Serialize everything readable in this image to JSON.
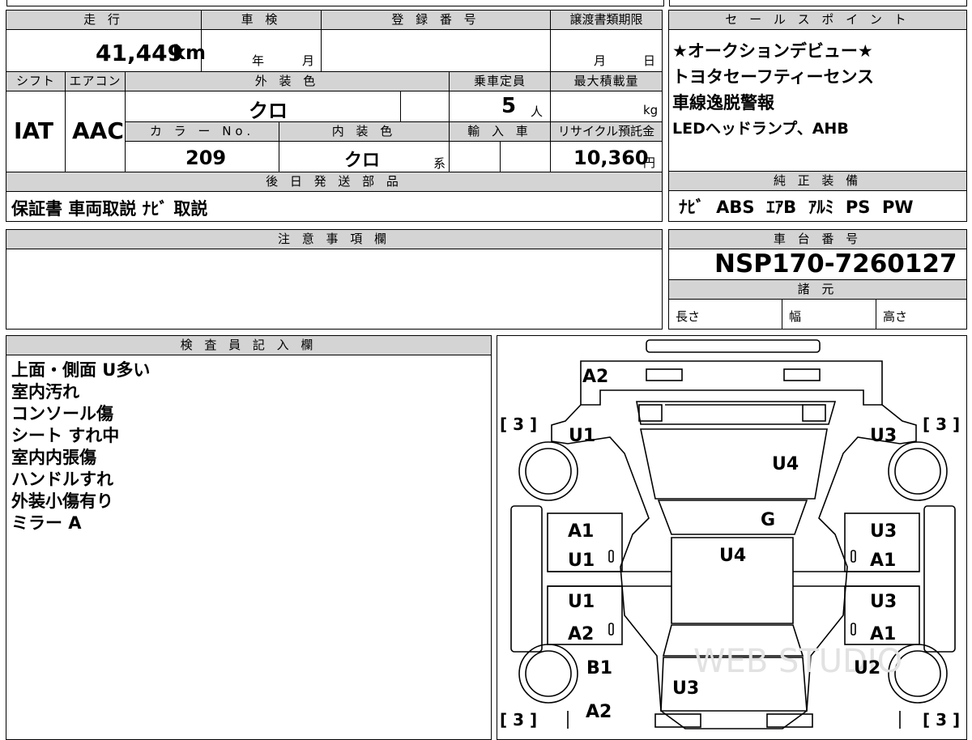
{
  "top_table": {
    "mileage": {
      "header": "走 行",
      "value": "41,449",
      "unit": "km"
    },
    "inspection": {
      "header": "車 検",
      "year_label": "年",
      "month_label": "月"
    },
    "registration": {
      "header": "登 録 番 号",
      "value": ""
    },
    "transfer_deadline": {
      "header": "譲渡書類期限",
      "month_label": "月",
      "day_label": "日"
    },
    "shift": {
      "header": "シフト",
      "value": "IAT"
    },
    "aircon": {
      "header": "エアコン",
      "value": "AAC"
    },
    "exterior_color": {
      "header": "外 装 色",
      "value": "クロ"
    },
    "capacity": {
      "header": "乗車定員",
      "value": "5",
      "unit": "人"
    },
    "max_load": {
      "header": "最大積載量",
      "unit": "kg"
    },
    "color_no": {
      "header": "カ ラ ー No.",
      "value": "209"
    },
    "interior_color": {
      "header": "内 装 色",
      "value": "クロ",
      "suffix": "系"
    },
    "import": {
      "header": "輸 入 車"
    },
    "recycle_fee": {
      "header": "リサイクル預託金",
      "value": "10,360",
      "unit": "円"
    },
    "later_shipped": {
      "header": "後 日 発 送 部 品",
      "value": "保証書 車両取説 ﾅﾋﾞ 取説"
    }
  },
  "sales_point": {
    "header": "セ ー ル ス ポ イ ン ト",
    "lines": [
      "★オークションデビュー★",
      "トヨタセーフティーセンス",
      "車線逸脱警報",
      "LEDヘッドランプ、AHB"
    ]
  },
  "standard_equipment": {
    "header": "純 正 装 備",
    "value": "ﾅﾋﾞ  ABS  ｴｱB  ｱﾙﾐ  PS  PW"
  },
  "caution": {
    "header": "注 意 事 項 欄",
    "value": ""
  },
  "chassis_number": {
    "header": "車 台 番 号",
    "value": "NSP170-7260127"
  },
  "specs": {
    "header": "諸 元",
    "length_label": "長さ",
    "width_label": "幅",
    "height_label": "高さ"
  },
  "inspector_notes": {
    "header": "検 査 員 記 入 欄",
    "lines": [
      "上面・側面 U多い",
      "室内汚れ",
      "コンソール傷",
      "シート すれ中",
      "室内内張傷",
      "ハンドルすれ",
      "外装小傷有り",
      "ミラー A"
    ]
  },
  "diagram": {
    "labels": {
      "rear_bumper": "A2",
      "rear_left_fender": "U1",
      "rear_right_fender": "U3",
      "rear_glass": "U4",
      "rear_door_glass": "G",
      "roof": "U4",
      "left_rear_door_top": "A1",
      "left_rear_door_bottom": "U1",
      "right_rear_door_top": "U3",
      "right_rear_door_bottom": "A1",
      "left_front_door_top": "U1",
      "left_front_door_bottom": "A2",
      "right_front_door_top": "U3",
      "right_front_door_bottom": "A1",
      "left_front_fender": "B1",
      "right_front_fender": "U2",
      "hood": "U3",
      "front_bumper": "A2",
      "tire_rear_left": "[ 3 ]",
      "tire_rear_right": "[ 3 ]",
      "tire_front_left": "[ 3 ]",
      "tire_front_right": "[ 3 ]"
    },
    "watermark": "WEB STUDIO"
  }
}
